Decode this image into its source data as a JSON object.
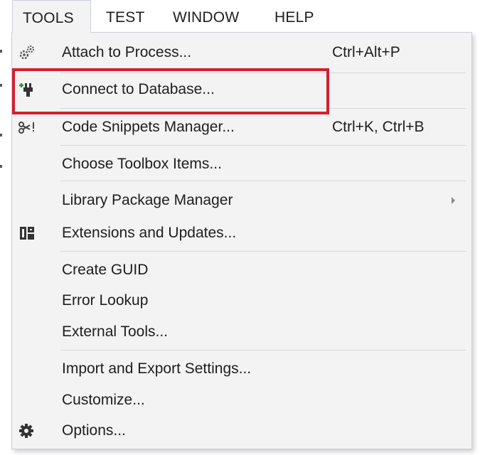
{
  "menubar": {
    "items": [
      {
        "label": "TOOLS",
        "active": true
      },
      {
        "label": "TEST"
      },
      {
        "label": "WINDOW"
      },
      {
        "label": "HELP"
      }
    ]
  },
  "tools_menu": {
    "items": [
      {
        "label": "Attach to Process...",
        "shortcut": "Ctrl+Alt+P",
        "icon": "attach-process-icon"
      },
      {
        "label": "Connect to Database...",
        "shortcut": "",
        "icon": "connect-database-icon",
        "highlighted": true
      },
      {
        "label": "Code Snippets Manager...",
        "shortcut": "Ctrl+K, Ctrl+B",
        "icon": "code-snippets-icon"
      },
      {
        "label": "Choose Toolbox Items...",
        "shortcut": ""
      },
      {
        "label": "Library Package Manager",
        "shortcut": "",
        "submenu": true
      },
      {
        "label": "Extensions and Updates...",
        "shortcut": "",
        "icon": "extensions-icon"
      },
      {
        "label": "Create GUID",
        "shortcut": ""
      },
      {
        "label": "Error Lookup",
        "shortcut": ""
      },
      {
        "label": "External Tools...",
        "shortcut": ""
      },
      {
        "label": "Import and Export Settings...",
        "shortcut": ""
      },
      {
        "label": "Customize...",
        "shortcut": ""
      },
      {
        "label": "Options...",
        "shortcut": "",
        "icon": "gear-icon"
      }
    ]
  },
  "colors": {
    "menu_background": "#f3f3f3",
    "menu_border": "#cccedb",
    "highlight_border": "#d2202f",
    "text": "#1e1e1e"
  }
}
